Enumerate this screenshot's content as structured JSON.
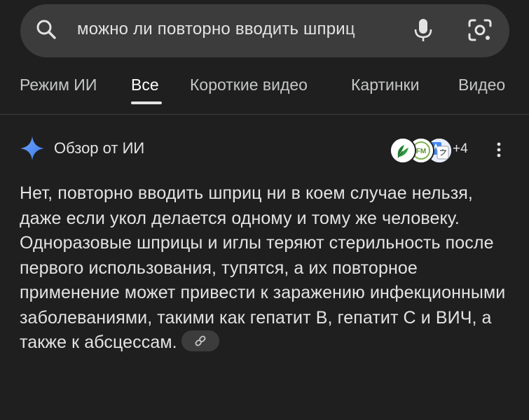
{
  "search": {
    "query": "можно ли повторно вводить шприц"
  },
  "tabs": [
    {
      "label": "Режим ИИ"
    },
    {
      "label": "Все",
      "active": true
    },
    {
      "label": "Короткие видео"
    },
    {
      "label": "Картинки"
    },
    {
      "label": "Видео"
    }
  ],
  "overview": {
    "title": "Обзор от ИИ",
    "sources_extra": "+4",
    "answer": "Нет, повторно вводить шприц ни в коем случае нельзя, даже если укол делается одному и тому же человеку. Одноразовые шприцы и иглы теряют стерильность после первого использования, тупятся, а их повторное применение может привести к заражению инфекционными заболеваниями, такими как гепатит B, гепатит C и ВИЧ, а также к абсцессам.",
    "source_icons": [
      "leaf-logo-icon",
      "fm-logo-icon",
      "translate-logo-icon"
    ]
  },
  "colors": {
    "background": "#1f1f1f",
    "search_bar": "#3c3c3c",
    "text": "#e3e3e3",
    "gemini_blue": "#4f8df5"
  }
}
